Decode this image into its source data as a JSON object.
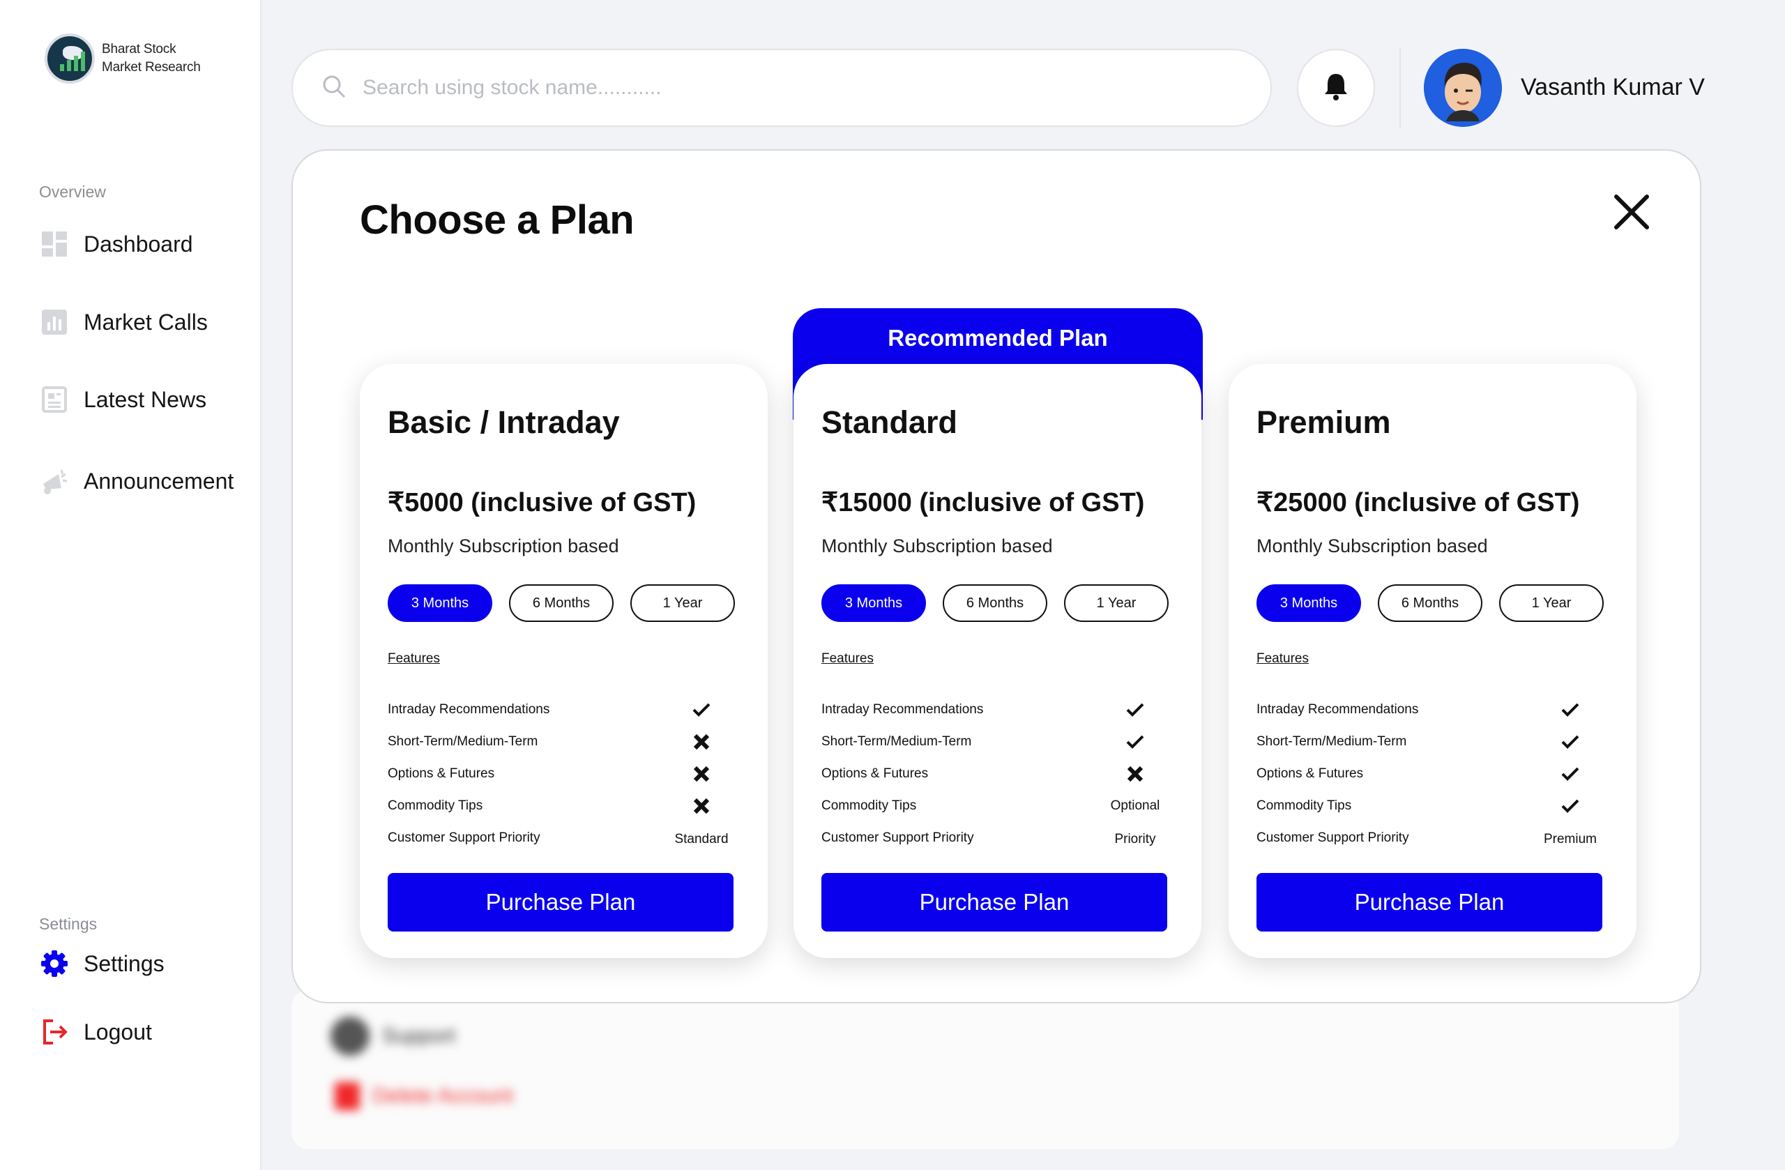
{
  "brand": {
    "name_line1": "Bharat Stock",
    "name_line2": "Market Research"
  },
  "sidebar": {
    "overview_label": "Overview",
    "items": [
      {
        "label": "Dashboard",
        "icon": "dashboard-icon"
      },
      {
        "label": "Market Calls",
        "icon": "bar-chart-icon"
      },
      {
        "label": "Latest News",
        "icon": "news-icon"
      },
      {
        "label": "Announcement",
        "icon": "megaphone-icon"
      }
    ],
    "settings_label": "Settings",
    "settings_item": "Settings",
    "logout_item": "Logout"
  },
  "search": {
    "placeholder": "Search using stock name..........."
  },
  "user": {
    "name": "Vasanth Kumar V"
  },
  "background": {
    "support_label": "Support",
    "delete_label": "Delete Account"
  },
  "modal": {
    "title": "Choose a Plan",
    "recommended_label": "Recommended Plan",
    "features_label": "Features",
    "purchase_label": "Purchase Plan",
    "durations": [
      "3 Months",
      "6 Months",
      "1 Year"
    ],
    "feature_names": [
      "Intraday Recommendations",
      "Short-Term/Medium-Term",
      "Options & Futures",
      "Commodity Tips",
      "Customer Support Priority"
    ],
    "plans": [
      {
        "name": "Basic / Intraday",
        "price": "₹5000 (inclusive of GST)",
        "subtitle": "Monthly Subscription based",
        "selected_duration": "3 Months",
        "features": [
          "check",
          "cross",
          "cross",
          "cross",
          "Standard"
        ]
      },
      {
        "name": "Standard",
        "price": "₹15000 (inclusive of GST)",
        "subtitle": "Monthly Subscription based",
        "selected_duration": "3 Months",
        "features": [
          "check",
          "check",
          "cross",
          "Optional",
          "Priority"
        ]
      },
      {
        "name": "Premium",
        "price": "₹25000 (inclusive of GST)",
        "subtitle": "Monthly Subscription based",
        "selected_duration": "3 Months",
        "features": [
          "check",
          "check",
          "check",
          "check",
          "Premium"
        ]
      }
    ]
  },
  "colors": {
    "accent": "#0a00ee",
    "logout": "#e5262c",
    "avatar_bg": "#1f5fe0"
  }
}
